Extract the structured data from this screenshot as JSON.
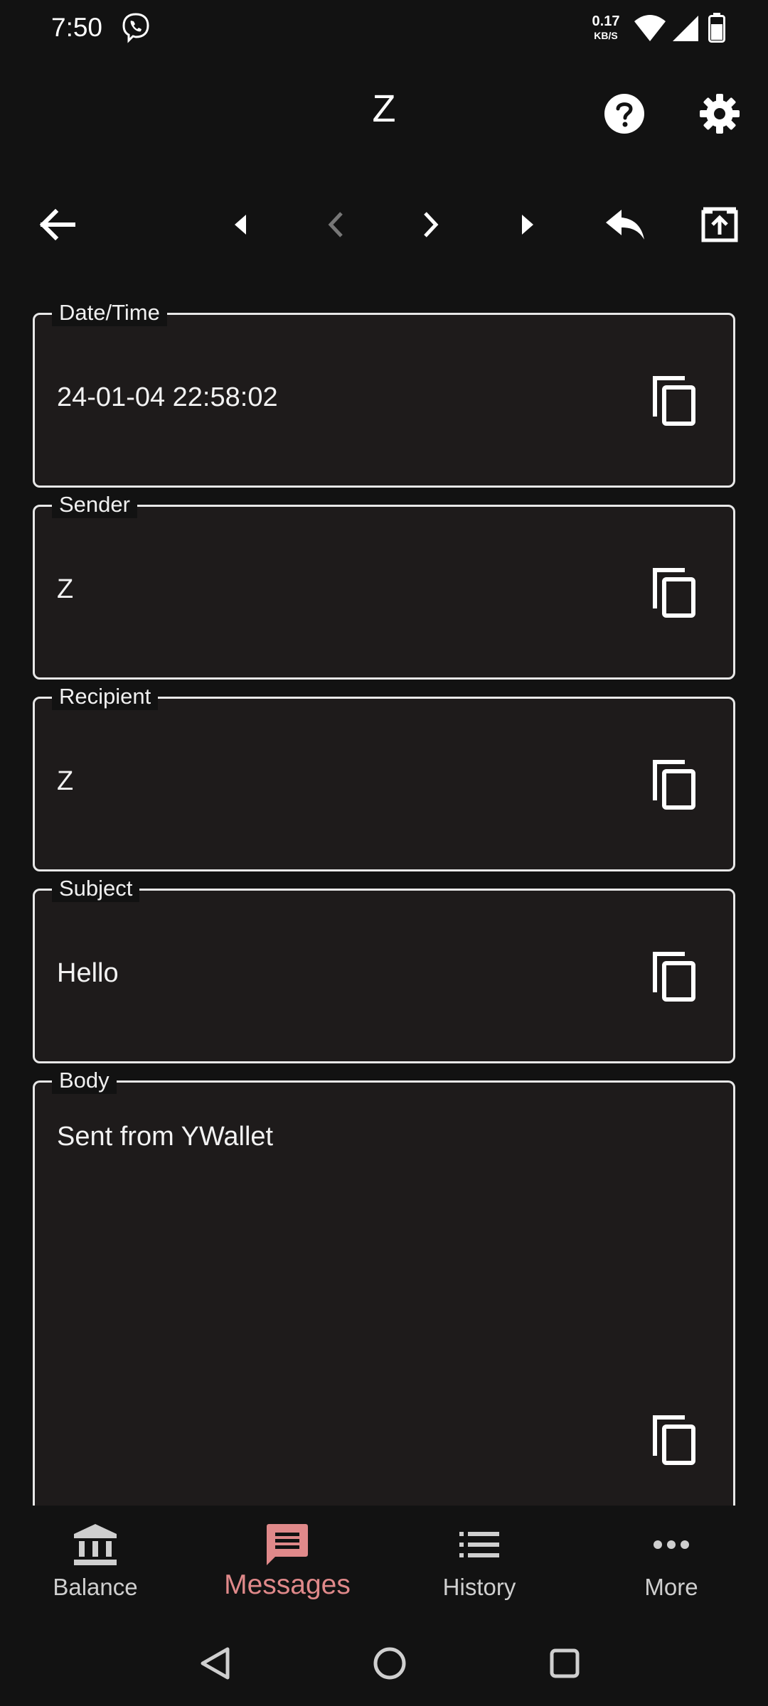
{
  "status_bar": {
    "time": "7:50",
    "speed_value": "0.17",
    "speed_unit": "KB/S",
    "icons": [
      "viber-icon",
      "wifi-icon",
      "signal-icon",
      "battery-icon"
    ]
  },
  "header": {
    "title": "Z",
    "icons": [
      "help-icon",
      "settings-icon"
    ]
  },
  "toolbar": {
    "icons": [
      "back-arrow-icon",
      "first-message-icon",
      "previous-message-icon",
      "next-message-icon",
      "last-message-icon",
      "reply-icon",
      "open-external-icon"
    ]
  },
  "fields": {
    "datetime": {
      "label": "Date/Time",
      "value": "24-01-04 22:58:02"
    },
    "sender": {
      "label": "Sender",
      "value": "Z"
    },
    "recipient": {
      "label": "Recipient",
      "value": "Z"
    },
    "subject": {
      "label": "Subject",
      "value": "Hello"
    },
    "body": {
      "label": "Body",
      "value": "Sent from YWallet"
    }
  },
  "bottom_nav": {
    "balance": "Balance",
    "messages": "Messages",
    "history": "History",
    "more": "More",
    "active": "Messages"
  },
  "colors": {
    "background": "#121212",
    "field_background": "#1e1b1b",
    "accent": "#e0898a",
    "disabled_icon": "#777777"
  }
}
